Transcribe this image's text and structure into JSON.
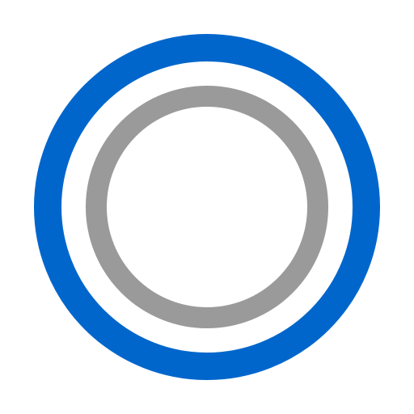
{
  "icon": {
    "name": "concentric-rings-icon",
    "colors": {
      "background": "#ffffff",
      "outer_ring": "#0066cc",
      "inner_ring": "#9a9a9a"
    }
  }
}
